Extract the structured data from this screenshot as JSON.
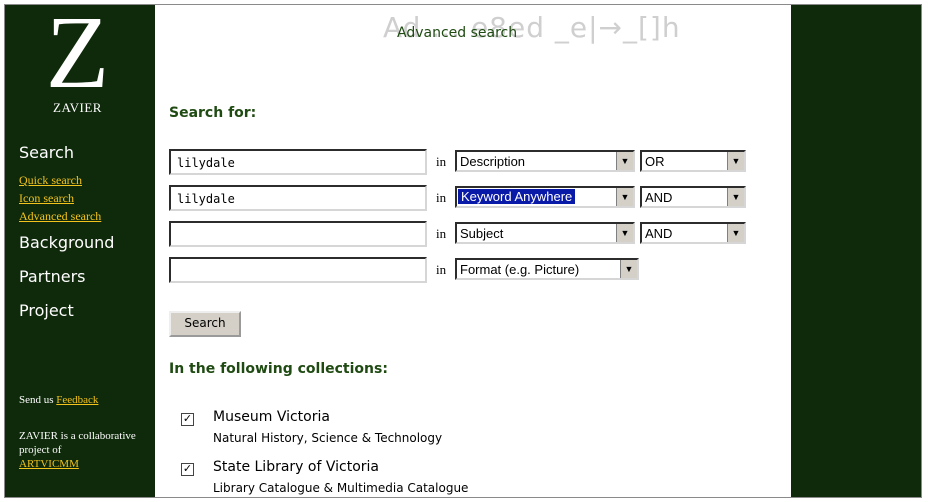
{
  "sidebar": {
    "logo_letter": "Z",
    "logo_name": "ZAVIER",
    "search": "Search",
    "quick_search": "Quick search",
    "icon_search": "Icon search",
    "advanced_search": "Advanced search",
    "background": "Background",
    "partners": "Partners",
    "project": "Project",
    "feedback_prefix": "Send us ",
    "feedback_link": "Feedback",
    "about_text": "ZAVIER is a collaborative project of",
    "about_link": "ARTVICMM"
  },
  "header": {
    "title": "Advanced search",
    "ghost_text": "Ad ... e8ed _e|→_[]h"
  },
  "form": {
    "search_for_label": "Search for:",
    "in_label": "in",
    "rows": [
      {
        "term": "lilydale",
        "field": "Description",
        "operator": "OR"
      },
      {
        "term": "lilydale",
        "field": "Keyword Anywhere",
        "operator": "AND"
      },
      {
        "term": "",
        "field": "Subject",
        "operator": "AND"
      },
      {
        "term": "",
        "field": "Format (e.g. Picture)",
        "operator": ""
      }
    ],
    "search_button": "Search"
  },
  "collections": {
    "label": "In the following collections:",
    "items": [
      {
        "name": "Museum Victoria",
        "desc": "Natural History, Science & Technology",
        "checked": true
      },
      {
        "name": "State Library of Victoria",
        "desc": "Library Catalogue & Multimedia Catalogue",
        "checked": true
      }
    ]
  },
  "colors": {
    "sidebar_bg": "#0f2a0b",
    "link_yellow": "#f2c31c",
    "heading_green": "#1f4a12",
    "highlight_blue": "#0a1aa8"
  }
}
